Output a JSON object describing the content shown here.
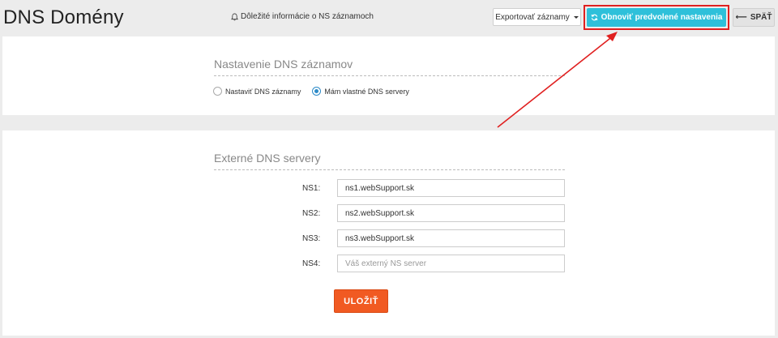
{
  "header": {
    "title": "DNS Domény",
    "notice": "Dôležité informácie o NS záznamoch",
    "export_label": "Exportovať záznamy",
    "restore_label": "Obnoviť predvolené nastavenia",
    "back_label": "SPÄŤ"
  },
  "dns_settings": {
    "title": "Nastavenie DNS záznamov",
    "options": [
      {
        "label": "Nastaviť DNS záznamy",
        "checked": false
      },
      {
        "label": "Mám vlastné DNS servery",
        "checked": true
      }
    ]
  },
  "external_dns": {
    "title": "Externé DNS servery",
    "rows": [
      {
        "label": "NS1:",
        "value": "ns1.webSupport.sk",
        "placeholder": ""
      },
      {
        "label": "NS2:",
        "value": "ns2.webSupport.sk",
        "placeholder": ""
      },
      {
        "label": "NS3:",
        "value": "ns3.webSupport.sk",
        "placeholder": ""
      },
      {
        "label": "NS4:",
        "value": "",
        "placeholder": "Váš externý NS server"
      }
    ],
    "save_label": "ULOŽIŤ"
  },
  "colors": {
    "restore_button": "#2ec0da",
    "save_button": "#f15a22",
    "annotation": "#e02020"
  }
}
